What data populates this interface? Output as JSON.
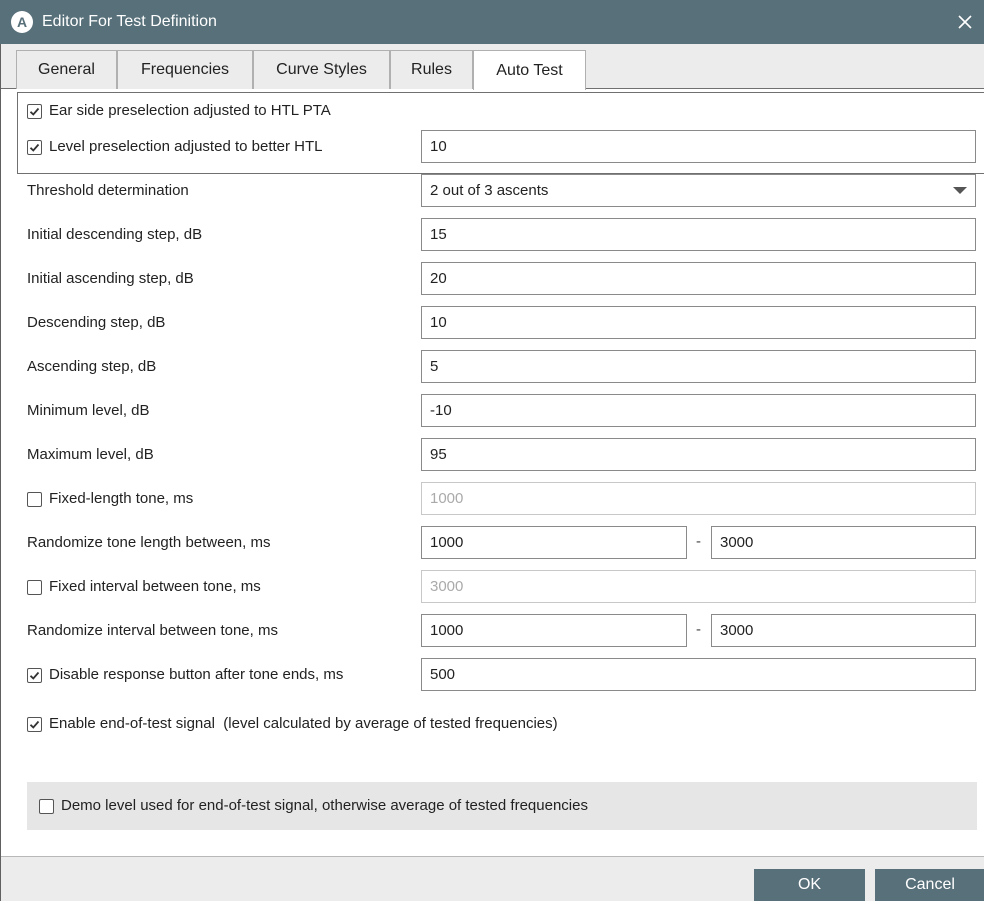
{
  "window": {
    "app_icon_letter": "A",
    "title": "Editor For Test Definition",
    "close_glyph": "✕"
  },
  "tabs": [
    {
      "label": "General",
      "active": false
    },
    {
      "label": "Frequencies",
      "active": false
    },
    {
      "label": "Curve Styles",
      "active": false
    },
    {
      "label": "Rules",
      "active": false
    },
    {
      "label": "Auto Test",
      "active": true
    }
  ],
  "form": {
    "ear_side": {
      "label": "Ear side preselection adjusted to HTL PTA",
      "checked": true
    },
    "level_preselection": {
      "label": "Level preselection adjusted to better HTL",
      "checked": true,
      "value": "10"
    },
    "threshold": {
      "label": "Threshold determination",
      "value": "2 out of 3 ascents"
    },
    "initial_descending": {
      "label": "Initial descending step, dB",
      "value": "15"
    },
    "initial_ascending": {
      "label": "Initial ascending step, dB",
      "value": "20"
    },
    "descending": {
      "label": "Descending step, dB",
      "value": "10"
    },
    "ascending": {
      "label": "Ascending step, dB",
      "value": "5"
    },
    "minimum_level": {
      "label": "Minimum level, dB",
      "value": "-10"
    },
    "maximum_level": {
      "label": "Maximum level, dB",
      "value": "95"
    },
    "fixed_length": {
      "label": "Fixed-length tone, ms",
      "checked": false,
      "value": "1000"
    },
    "randomize_length": {
      "label": "Randomize tone length between, ms",
      "from": "1000",
      "separator": "-",
      "to": "3000"
    },
    "fixed_interval": {
      "label": "Fixed interval between tone, ms",
      "checked": false,
      "value": "3000"
    },
    "randomize_interval": {
      "label": "Randomize interval between tone, ms",
      "from": "1000",
      "separator": "-",
      "to": "3000"
    },
    "disable_response": {
      "label": "Disable response button after tone ends, ms",
      "checked": true,
      "value": "500"
    },
    "end_signal": {
      "label": "Enable end-of-test signal  (level calculated by average of tested frequencies)",
      "checked": true
    },
    "demo_level": {
      "label": "Demo level used for end-of-test signal, otherwise average of tested frequencies",
      "checked": false
    }
  },
  "buttons": {
    "ok": "OK",
    "cancel": "Cancel"
  },
  "colors": {
    "accent": "#58707a",
    "tab_bar": "#ececec",
    "demo_panel": "#e6e6e6"
  },
  "icons": {
    "check": "checkmark-icon",
    "dropdown": "chevron-down-icon",
    "close": "close-icon"
  }
}
